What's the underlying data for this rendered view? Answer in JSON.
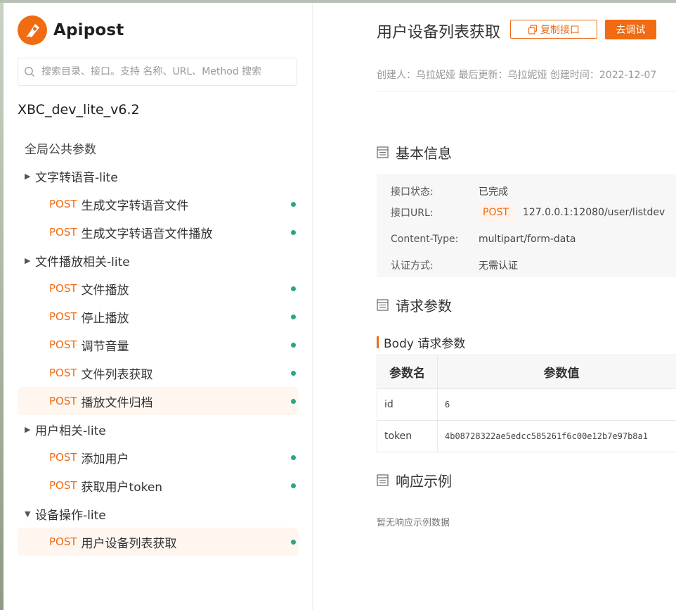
{
  "app": {
    "name": "Apipost"
  },
  "search": {
    "placeholder": "搜索目录、接口。支持 名称、URL、Method 搜索"
  },
  "project": {
    "name": "XBC_dev_lite_v6.2"
  },
  "tree": {
    "global": "全局公共参数",
    "folders": [
      {
        "name": "文字转语音-lite",
        "expanded": false,
        "items": [
          {
            "method": "POST",
            "name": "生成文字转语音文件"
          },
          {
            "method": "POST",
            "name": "生成文字转语音文件播放"
          }
        ]
      },
      {
        "name": "文件播放相关-lite",
        "expanded": false,
        "items": [
          {
            "method": "POST",
            "name": "文件播放"
          },
          {
            "method": "POST",
            "name": "停止播放"
          },
          {
            "method": "POST",
            "name": "调节音量"
          },
          {
            "method": "POST",
            "name": "文件列表获取"
          },
          {
            "method": "POST",
            "name": "播放文件归档"
          }
        ]
      },
      {
        "name": "用户相关-lite",
        "expanded": false,
        "items": [
          {
            "method": "POST",
            "name": "添加用户"
          },
          {
            "method": "POST",
            "name": "获取用户token"
          }
        ]
      },
      {
        "name": "设备操作-lite",
        "expanded": true,
        "items": [
          {
            "method": "POST",
            "name": "用户设备列表获取"
          }
        ]
      }
    ]
  },
  "doc": {
    "title": "用户设备列表获取",
    "copy_label": "复制接口",
    "debug_label": "去调试",
    "meta": "创建人：乌拉妮娅 最后更新：乌拉妮娅 创建时间：2022-12-07",
    "basic_title": "基本信息",
    "info": {
      "status_label": "接口状态:",
      "status_value": "已完成",
      "url_label": "接口URL:",
      "url_method": "POST",
      "url_value": "127.0.0.1:12080/user/listdev",
      "ct_label": "Content-Type:",
      "ct_value": "multipart/form-data",
      "auth_label": "认证方式:",
      "auth_value": "无需认证"
    },
    "request_title": "请求参数",
    "body_title": "Body 请求参数",
    "table": {
      "headers": [
        "参数名",
        "参数值"
      ],
      "rows": [
        {
          "name": "id",
          "value": "6"
        },
        {
          "name": "token",
          "value": "4b08728322ae5edcc585261f6c00e12b7e97b8a1"
        }
      ]
    },
    "response_title": "响应示例",
    "response_empty": "暂无响应示例数据"
  },
  "colors": {
    "accent": "#f06b12",
    "status_dot": "#2aa58a"
  }
}
